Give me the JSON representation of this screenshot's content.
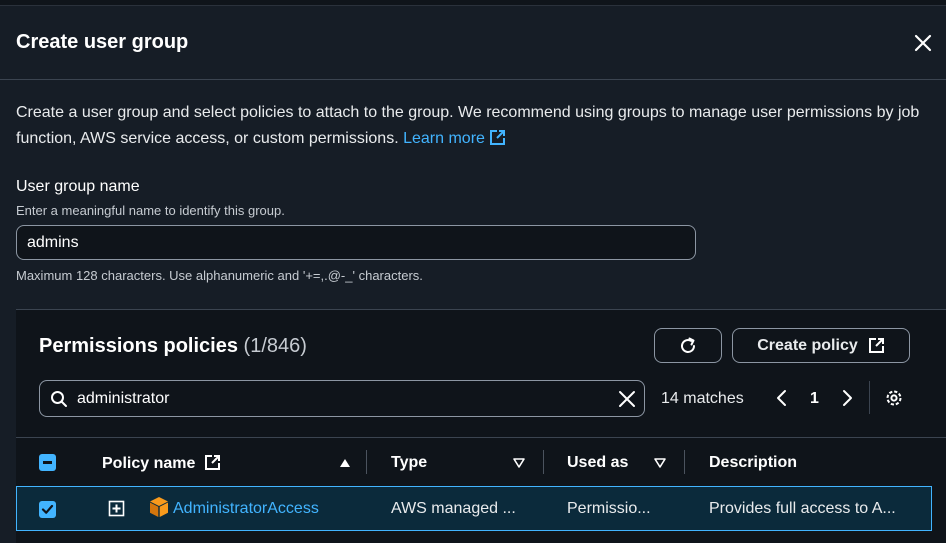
{
  "modal": {
    "title": "Create user group",
    "intro": "Create a user group and select policies to attach to the group. We recommend using groups to manage user permissions by job function, AWS service access, or custom permissions.",
    "learn_more": "Learn more"
  },
  "group_name": {
    "label": "User group name",
    "hint": "Enter a meaningful name to identify this group.",
    "value": "admins",
    "constraint": "Maximum 128 characters. Use alphanumeric and '+=,.@-_' characters."
  },
  "policies": {
    "title": "Permissions policies",
    "count": "(1/846)",
    "create_label": "Create policy",
    "search_value": "administrator",
    "matches": "14 matches",
    "page": "1",
    "columns": [
      "Policy name",
      "Type",
      "Used as",
      "Description"
    ],
    "rows": [
      {
        "name": "AdministratorAccess",
        "type": "AWS managed ...",
        "used_as": "Permissio...",
        "description": "Provides full access to A..."
      }
    ]
  },
  "colors": {
    "background": "#161d26",
    "panel": "#0f141a",
    "accent": "#42b4ff",
    "package_icon": "#f89a1c",
    "selected_row": "#0b2a3b"
  },
  "icons": [
    "close-icon",
    "external-link-icon",
    "refresh-icon",
    "search-icon",
    "clear-icon",
    "chevron-left-icon",
    "chevron-right-icon",
    "settings-icon",
    "sort-ascending-icon",
    "sort-icon",
    "expand-icon",
    "package-icon"
  ]
}
